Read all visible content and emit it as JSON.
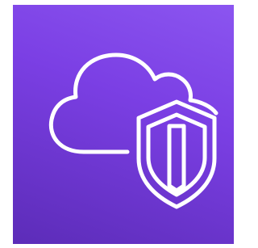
{
  "icon": {
    "name": "cloud-shield-icon",
    "background_colors": [
      "#8b55f0",
      "#7b3fe4",
      "#5c2cb8"
    ],
    "stroke_color": "#ffffff"
  }
}
